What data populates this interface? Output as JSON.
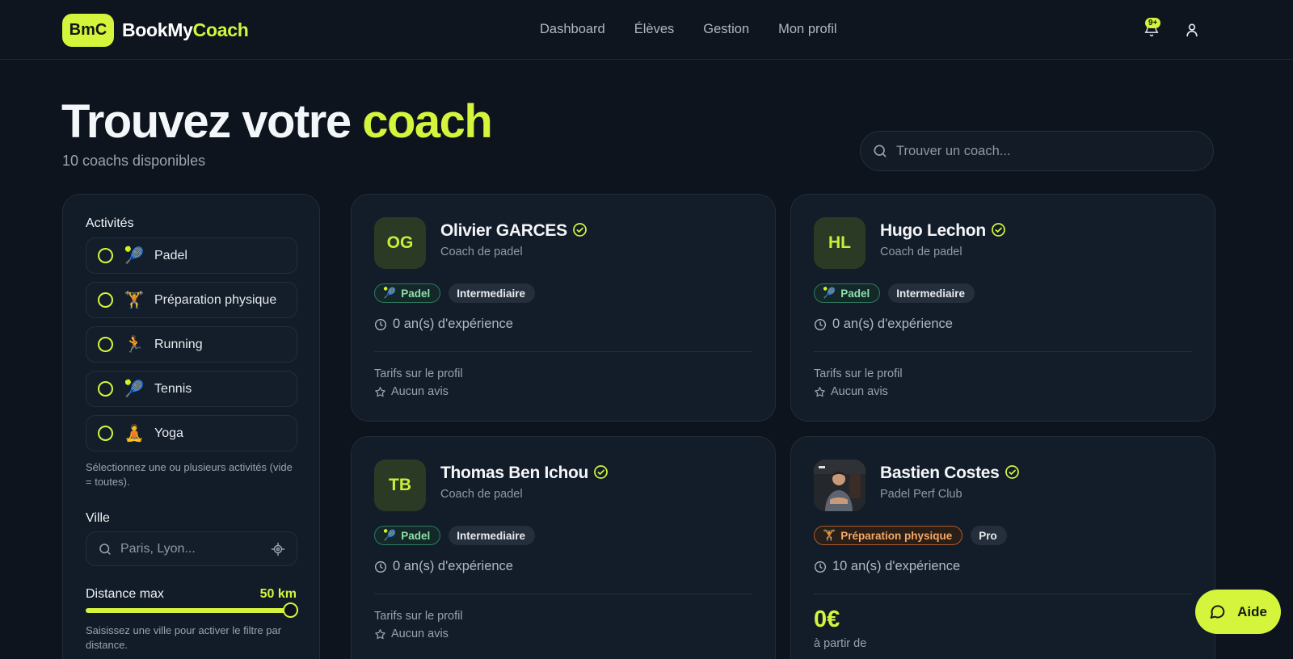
{
  "brand": {
    "badge": "BmC",
    "name_part1": "BookMy",
    "name_part2": "Coach"
  },
  "nav": [
    "Dashboard",
    "Élèves",
    "Gestion",
    "Mon profil"
  ],
  "notifications": {
    "badge": "9+"
  },
  "hero": {
    "title_part1": "Trouvez votre ",
    "title_part2": "coach",
    "subtitle": "10 coachs disponibles"
  },
  "search": {
    "placeholder": "Trouver un coach..."
  },
  "filters": {
    "activities_heading": "Activités",
    "activities": [
      {
        "label": "Padel",
        "emoji": "🎾"
      },
      {
        "label": "Préparation physique",
        "emoji": "🏋"
      },
      {
        "label": "Running",
        "emoji": "🏃"
      },
      {
        "label": "Tennis",
        "emoji": "🎾"
      },
      {
        "label": "Yoga",
        "emoji": "🧘"
      }
    ],
    "activities_hint": "Sélectionnez une ou plusieurs activités (vide = toutes).",
    "city_heading": "Ville",
    "city_placeholder": "Paris, Lyon...",
    "distance_label": "Distance max",
    "distance_value": "50 km",
    "distance_hint": "Saisissez une ville pour activer le filtre par distance."
  },
  "coaches": [
    {
      "initials": "OG",
      "name": "Olivier GARCES",
      "subtitle": "Coach de padel",
      "sport": "Padel",
      "sport_emoji": "🎾",
      "level": "Intermediaire",
      "experience": "0 an(s) d'expérience",
      "price_note": "Tarifs sur le profil",
      "reviews": "Aucun avis"
    },
    {
      "initials": "HL",
      "name": "Hugo Lechon",
      "subtitle": "Coach de padel",
      "sport": "Padel",
      "sport_emoji": "🎾",
      "level": "Intermediaire",
      "experience": "0 an(s) d'expérience",
      "price_note": "Tarifs sur le profil",
      "reviews": "Aucun avis"
    },
    {
      "initials": "TB",
      "name": "Thomas Ben Ichou",
      "subtitle": "Coach de padel",
      "sport": "Padel",
      "sport_emoji": "🎾",
      "level": "Intermediaire",
      "experience": "0 an(s) d'expérience",
      "price_note": "Tarifs sur le profil",
      "reviews": "Aucun avis"
    },
    {
      "name": "Bastien Costes",
      "subtitle": "Padel Perf Club",
      "sport": "Préparation physique",
      "sport_emoji": "🏋",
      "level": "Pro",
      "experience": "10 an(s) d'expérience",
      "price": "0€",
      "price_from": "à partir de"
    }
  ],
  "help": {
    "label": "Aide"
  },
  "colors": {
    "accent": "#d4f53c",
    "background": "#0d141d",
    "card": "#131d29"
  }
}
